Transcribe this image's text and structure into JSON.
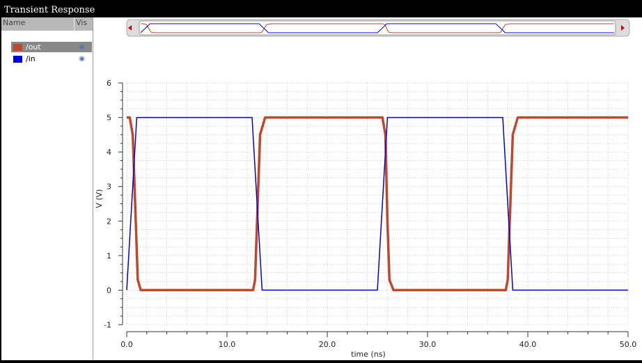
{
  "window": {
    "title": "Transient Response"
  },
  "legend_panel": {
    "col_name": "Name",
    "col_vis": "Vis",
    "items": [
      {
        "label": "/out",
        "color": "#c0462c",
        "selected": true,
        "icon": "eye-icon"
      },
      {
        "label": "/in",
        "color": "#0000e0",
        "selected": false,
        "icon": "eye-icon"
      }
    ]
  },
  "chart_data": {
    "type": "line",
    "title": "",
    "xlabel": "time (ns)",
    "ylabel": "V (V)",
    "xlim": [
      0,
      50
    ],
    "ylim": [
      -1,
      6
    ],
    "xticks": [
      "0.0",
      "10.0",
      "20.0",
      "30.0",
      "40.0",
      "50.0"
    ],
    "yticks": [
      "-1",
      "0",
      "1",
      "2",
      "3",
      "4",
      "5",
      "6"
    ],
    "grid": true,
    "series": [
      {
        "name": "/out",
        "color": "#c0462c",
        "points": [
          [
            0,
            5
          ],
          [
            0.3,
            5
          ],
          [
            0.6,
            4.5
          ],
          [
            0.9,
            2
          ],
          [
            1.1,
            0.3
          ],
          [
            1.4,
            0
          ],
          [
            12.6,
            0
          ],
          [
            12.8,
            0.3
          ],
          [
            13.0,
            2
          ],
          [
            13.3,
            4.5
          ],
          [
            13.8,
            5
          ],
          [
            25.5,
            5
          ],
          [
            25.8,
            4.5
          ],
          [
            26.0,
            2
          ],
          [
            26.2,
            0.3
          ],
          [
            26.6,
            0
          ],
          [
            37.8,
            0
          ],
          [
            38.0,
            0.3
          ],
          [
            38.2,
            2
          ],
          [
            38.5,
            4.5
          ],
          [
            39,
            5
          ],
          [
            50,
            5
          ]
        ]
      },
      {
        "name": "/in",
        "color": "#0000e0",
        "points": [
          [
            0,
            0
          ],
          [
            1,
            5
          ],
          [
            12.5,
            5
          ],
          [
            13.5,
            0
          ],
          [
            25,
            0
          ],
          [
            26,
            5
          ],
          [
            37.5,
            5
          ],
          [
            38.5,
            0
          ],
          [
            50,
            0
          ]
        ]
      }
    ]
  }
}
